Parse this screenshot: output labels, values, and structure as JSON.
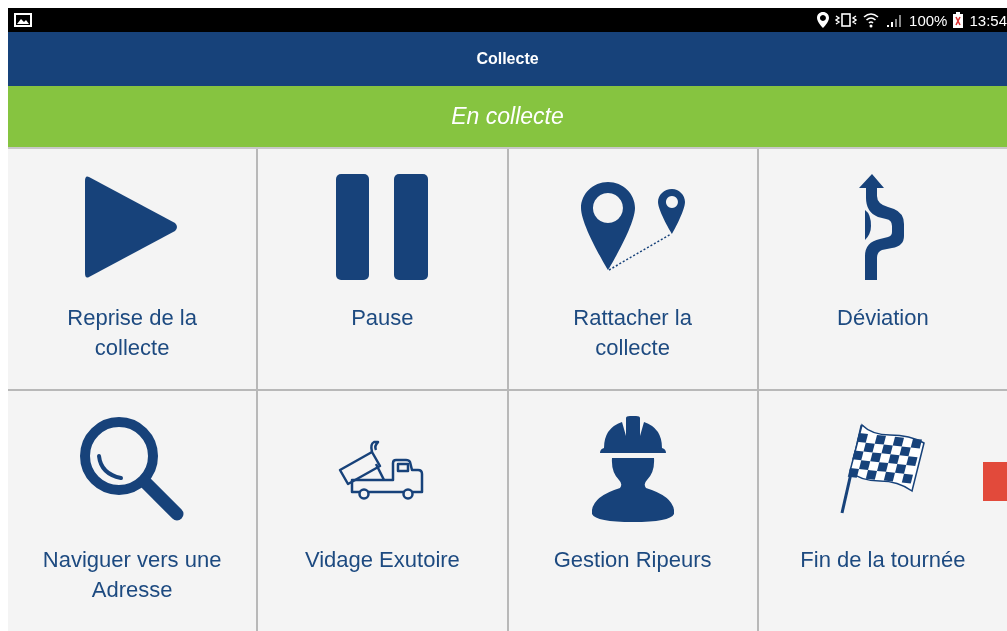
{
  "status_bar": {
    "battery": "100%",
    "time": "13:54"
  },
  "header": {
    "title": "Collecte"
  },
  "banner": {
    "text": "En collecte"
  },
  "tiles": [
    {
      "kind": "play",
      "label": "Reprise de la\ncollecte"
    },
    {
      "kind": "pause",
      "label": "Pause"
    },
    {
      "kind": "pins",
      "label": "Rattacher la\ncollecte"
    },
    {
      "kind": "detour",
      "label": "Déviation"
    },
    {
      "kind": "search",
      "label": "Naviguer vers une\nAdresse"
    },
    {
      "kind": "truck",
      "label": "Vidage Exutoire"
    },
    {
      "kind": "worker",
      "label": "Gestion Ripeurs"
    },
    {
      "kind": "flag",
      "label": "Fin de la tournée"
    }
  ]
}
